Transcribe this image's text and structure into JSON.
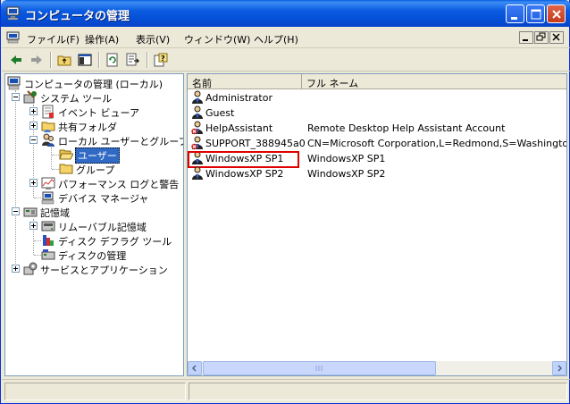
{
  "window": {
    "title": "コンピュータの管理"
  },
  "menu": {
    "file": "ファイル(F)",
    "action": "操作(A)",
    "view": "表示(V)",
    "window": "ウィンドウ(W)",
    "help": "ヘルプ(H)"
  },
  "toolbar": {
    "icons": [
      "back-arrow-icon",
      "forward-arrow-icon",
      "up-folder-icon",
      "show-hide-tree-icon",
      "refresh-icon",
      "export-list-icon",
      "help-icon"
    ]
  },
  "tree": {
    "root": "コンピュータの管理 (ローカル)",
    "system_tools": "システム ツール",
    "event_viewer": "イベント ビューア",
    "shared_folders": "共有フォルダ",
    "local_users": "ローカル ユーザーとグループ",
    "users": "ユーザー",
    "groups": "グループ",
    "performance": "パフォーマンス ログと警告",
    "device_manager": "デバイス マネージャ",
    "storage": "記憶域",
    "removable": "リムーバブル記憶域",
    "defrag": "ディスク デフラグ ツール",
    "disk_mgmt": "ディスクの管理",
    "services": "サービスとアプリケーション"
  },
  "list": {
    "columns": [
      "名前",
      "フル ネーム"
    ],
    "rows": [
      {
        "name": "Administrator",
        "full_name": "",
        "disabled": false
      },
      {
        "name": "Guest",
        "full_name": "",
        "disabled": false
      },
      {
        "name": "HelpAssistant",
        "full_name": "Remote Desktop Help Assistant Account",
        "disabled": true
      },
      {
        "name": "SUPPORT_388945a0",
        "full_name": "CN=Microsoft Corporation,L=Redmond,S=Washington,C...",
        "disabled": true
      },
      {
        "name": "WindowsXP SP1",
        "full_name": "WindowsXP SP1",
        "disabled": false
      },
      {
        "name": "WindowsXP SP2",
        "full_name": "WindowsXP SP2",
        "disabled": false
      }
    ],
    "highlighted_row": "WindowsXP SP1"
  },
  "colors": {
    "titlebar": "#0553d8",
    "selection": "#316ac5",
    "highlight_box": "#e00000"
  }
}
